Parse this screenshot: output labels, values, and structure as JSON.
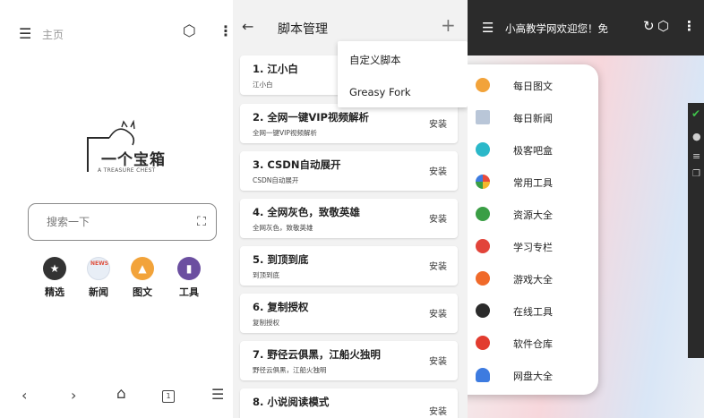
{
  "home": {
    "title": "主页",
    "logo_text": "一个宝箱",
    "logo_subtext": "A TREASURE CHEST",
    "search_placeholder": "搜索一下",
    "shortcuts": [
      {
        "label": "精选",
        "icon": "star-icon"
      },
      {
        "label": "新闻",
        "icon": "news-icon",
        "badge": "NEWS"
      },
      {
        "label": "图文",
        "icon": "image-icon"
      },
      {
        "label": "工具",
        "icon": "tools-icon"
      }
    ],
    "tabs_count": "1"
  },
  "scripts": {
    "title": "脚本管理",
    "menu": [
      "自定义脚本",
      "Greasy Fork"
    ],
    "items": [
      {
        "name": "1. 江小白",
        "desc": "江小白",
        "action": ""
      },
      {
        "name": "2. 全网一键VIP视频解析",
        "desc": "全网一键VIP视频解析",
        "action": "安装"
      },
      {
        "name": "3. CSDN自动展开",
        "desc": "CSDN自动展开",
        "action": "安装"
      },
      {
        "name": "4. 全网灰色，致敬英雄",
        "desc": "全网灰色，致敬英雄",
        "action": "安装"
      },
      {
        "name": "5. 到顶到底",
        "desc": "到顶到底",
        "action": "安装"
      },
      {
        "name": "6. 复制授权",
        "desc": "复制授权",
        "action": "安装"
      },
      {
        "name": "7. 野径云俱黑，江船火独明",
        "desc": "野径云俱黑，江船火独明",
        "action": "安装"
      },
      {
        "name": "8. 小说阅读模式",
        "desc": "",
        "action": "安装"
      }
    ]
  },
  "site": {
    "title": "小高教学网欢迎您！免",
    "drawer": [
      {
        "label": "每日图文",
        "icon": "image-icon",
        "color": "#f2a33a"
      },
      {
        "label": "每日新闻",
        "icon": "news-icon",
        "color": "#b9c6d8"
      },
      {
        "label": "极客吧盒",
        "icon": "box-icon",
        "color": "#2bb8c9"
      },
      {
        "label": "常用工具",
        "icon": "tools-icon",
        "color": "#e84b3c"
      },
      {
        "label": "资源大全",
        "icon": "resource-icon",
        "color": "#3a9e45"
      },
      {
        "label": "学习专栏",
        "icon": "study-icon",
        "color": "#e2443a"
      },
      {
        "label": "游戏大全",
        "icon": "game-icon",
        "color": "#f06a2a"
      },
      {
        "label": "在线工具",
        "icon": "compass-icon",
        "color": "#2b2b2b"
      },
      {
        "label": "软件仓库",
        "icon": "download-icon",
        "color": "#e23c2f"
      },
      {
        "label": "网盘大全",
        "icon": "cloud-icon",
        "color": "#3d7be0"
      }
    ]
  }
}
